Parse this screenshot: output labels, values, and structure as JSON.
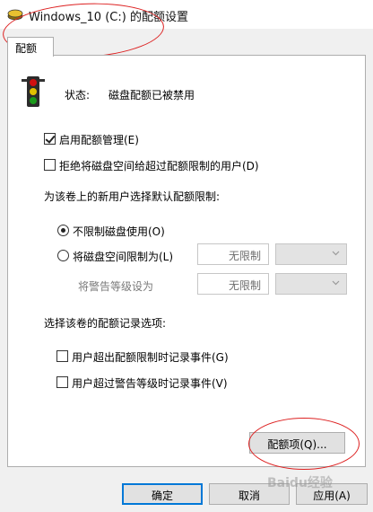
{
  "window": {
    "title": "Windows_10 (C:) 的配额设置"
  },
  "tabs": [
    {
      "label": "配额",
      "active": true
    }
  ],
  "status": {
    "label": "状态:",
    "value": "磁盘配额已被禁用",
    "icon": "traffic-light-icon"
  },
  "options": {
    "enable_quota": {
      "label": "启用配额管理(E)",
      "checked": true
    },
    "deny_space": {
      "label": "拒绝将磁盘空间给超过配额限制的用户(D)",
      "checked": false
    }
  },
  "default_limit": {
    "heading": "为该卷上的新用户选择默认配额限制:",
    "no_limit": {
      "label": "不限制磁盘使用(O)",
      "selected": true
    },
    "limit_to": {
      "label": "将磁盘空间限制为(L)",
      "selected": false,
      "value": "无限制",
      "unit": ""
    },
    "warning_level": {
      "label": "将警告等级设为",
      "value": "无限制",
      "unit": ""
    }
  },
  "logging": {
    "heading": "选择该卷的配额记录选项:",
    "log_over_limit": {
      "label": "用户超出配额限制时记录事件(G)",
      "checked": false
    },
    "log_over_warning": {
      "label": "用户超过警告等级时记录事件(V)",
      "checked": false
    }
  },
  "buttons": {
    "quota_entries": "配额项(Q)...",
    "ok": "确定",
    "cancel": "取消",
    "apply": "应用(A)"
  },
  "watermark": "Baidu经验",
  "colors": {
    "annotation": "#d22222",
    "accent": "#0078d7",
    "traffic_red": "#d01010",
    "traffic_yellow": "#e0c000",
    "traffic_green": "#1a9a1a"
  }
}
